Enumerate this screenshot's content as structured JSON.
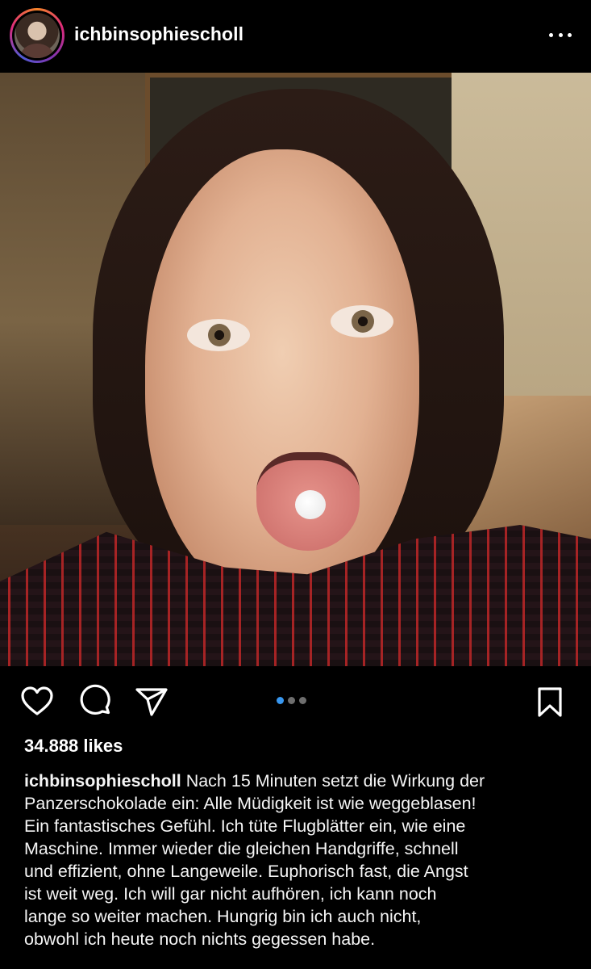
{
  "post": {
    "username": "ichbinsophiescholl",
    "likes": "34.888 likes",
    "caption_lines": [
      "Nach 15 Minuten setzt die Wirkung der",
      "Panzerschokolade ein: Alle Müdigkeit ist wie weggeblasen!",
      "Ein fantastisches Gefühl. Ich tüte Flugblätter ein, wie eine",
      "Maschine. Immer wieder die gleichen Handgriffe, schnell",
      "und effizient, ohne Langeweile. Euphorisch fast, die Angst",
      "ist weit weg. Ich will gar nicht aufhören, ich kann noch",
      "lange so weiter machen. Hungrig bin ich auch nicht,",
      "obwohl ich heute noch nichts gegessen habe."
    ],
    "carousel": {
      "total": 3,
      "active_index": 0,
      "active_color": "#3897f0",
      "inactive_color": "#6e6e6e"
    }
  },
  "icons": {
    "more": "more-options-icon",
    "like": "heart-icon",
    "comment": "comment-icon",
    "share": "share-icon",
    "save": "bookmark-icon"
  },
  "colors": {
    "background": "#000000",
    "text": "#ffffff",
    "story_ring": [
      "#f58529",
      "#dd2a7b",
      "#8134af"
    ]
  }
}
